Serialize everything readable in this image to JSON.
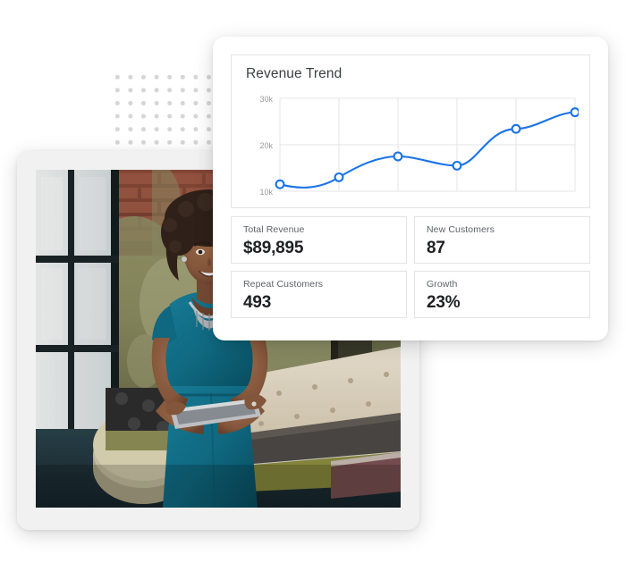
{
  "background_color": "#ffffff",
  "decoration": {
    "dot_grid": {
      "name": "dot-pattern",
      "dot_color": "#d6d6d6",
      "columns": 8,
      "rows": 7,
      "spacing_px": 14.6
    }
  },
  "dashboard": {
    "card_background": "#ffffff",
    "border_color": "#e4e4e4",
    "chart": {
      "title": "Revenue Trend",
      "accent_color": "#1a73e8",
      "y_ticks": [
        "30k",
        "20k",
        "10k"
      ]
    },
    "stats": [
      {
        "label": "Total Revenue",
        "value": "$89,895"
      },
      {
        "label": "New Customers",
        "value": "87"
      },
      {
        "label": "Repeat Customers",
        "value": "493"
      },
      {
        "label": "Growth",
        "value": "23%"
      }
    ]
  },
  "photo": {
    "name": "businesswoman-with-tablet-in-loft-interior",
    "alt": "Smiling woman in a teal dress holding a tablet, standing in a loft with exposed brick, distressed green wall, window light and a tufted cream banquette sofa",
    "frame_color": "#f1f1f1",
    "palette": {
      "dress_teal": "#0e6d87",
      "brick": "#7d4436",
      "wall_green": "#8d9167",
      "sofa_cream": "#e8e0cf",
      "cushion_dark": "#484644",
      "cushion_olive": "#8f9040",
      "cushion_maroon": "#7a5054",
      "floor_dark": "#1e3238",
      "window_light": "#e9eef0",
      "skin": "#8a5a3e",
      "hair": "#30211a"
    }
  },
  "chart_data": {
    "type": "line",
    "title": "Revenue Trend",
    "xlabel": "",
    "ylabel": "",
    "x": [
      1,
      2,
      3,
      4,
      5,
      6
    ],
    "categories": [
      "1",
      "2",
      "3",
      "4",
      "5",
      "6"
    ],
    "values": [
      11500,
      13000,
      17500,
      15500,
      23500,
      27000
    ],
    "series": [
      {
        "name": "Revenue",
        "values": [
          11500,
          13000,
          17500,
          15500,
          23500,
          27000
        ]
      }
    ],
    "ylim": [
      10000,
      30000
    ],
    "ytick_values": [
      10000,
      20000,
      30000
    ],
    "ytick_labels": [
      "10k",
      "20k",
      "30k"
    ],
    "grid": true,
    "grid_color": "#e4e4e4",
    "legend": "none",
    "line_color": "#1a73e8",
    "marker": "open-circle",
    "smooth": true
  }
}
